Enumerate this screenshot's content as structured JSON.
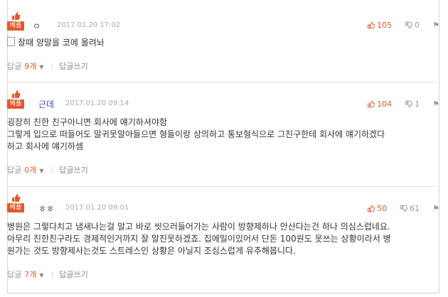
{
  "comments": [
    {
      "best_label": "베플",
      "author": "ㅇ",
      "date": "2017.01.20 17:02",
      "upvotes": "105",
      "downvotes": "0",
      "lines": [
        "잘때 양말을 코에 올려놔"
      ],
      "reply_label": "답글",
      "reply_count": "9개",
      "write_reply": "답글쓰기"
    },
    {
      "best_label": "베플",
      "author": "근데",
      "date": "2017.01.20 09:14",
      "upvotes": "104",
      "downvotes": "1",
      "lines": [
        "굉장히 친한 친구아니면 회사에 얘기하셔야함",
        "그렇게 입으로 떠들어도 말귀못알아들으면 형들이랑 상의하고 통보형식으로 그친구한테 회사에 얘기하겠다",
        "하고 회사에 얘기하셈"
      ],
      "reply_label": "답글",
      "reply_count": "0개",
      "write_reply": "답글쓰기"
    },
    {
      "best_label": "베플",
      "author": "ㅎㅎ",
      "date": "2017.01.20 09:01",
      "upvotes": "50",
      "downvotes": "61",
      "lines": [
        "병원은 그렇다치고 냄새나는걸 알고 바로 씻으러들어가는 사람이 방향제하나 안산다는건 하나 의심스럽네요.",
        "아무리 친한친구라도 경제적인거까지 잘 알진못하겠죠. 집에일이있어서 단돈 100원도 못쓰는 상황이라서 병",
        "원가는 것도 방향제사는것도 스트레스인 상황은 아닐지 조심스럽게 유추해봅니다."
      ],
      "reply_label": "답글",
      "reply_count": "7개",
      "write_reply": "답글쓰기"
    }
  ],
  "icons": {
    "thumb_up": "thumb-up-icon",
    "thumb_down": "thumb-down-icon",
    "report": "report-icon",
    "best": "best-badge-icon"
  },
  "colors": {
    "accent": "#e05a2b",
    "author": "#3355aa",
    "muted": "#999999"
  }
}
